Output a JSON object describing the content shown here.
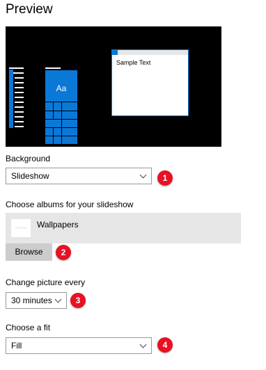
{
  "preview": {
    "title": "Preview",
    "tile_label": "Aa",
    "window_sample_text": "Sample Text"
  },
  "background": {
    "label": "Background",
    "value": "Slideshow",
    "badge": "1"
  },
  "albums": {
    "label": "Choose albums for your slideshow",
    "album_name": "Wallpapers",
    "browse_label": "Browse",
    "badge": "2"
  },
  "change_picture": {
    "label": "Change picture every",
    "value": "30 minutes",
    "badge": "3"
  },
  "fit": {
    "label": "Choose a fit",
    "value": "Fill",
    "badge": "4"
  },
  "colors": {
    "accent": "#0a78d7",
    "badge": "#e81123"
  }
}
